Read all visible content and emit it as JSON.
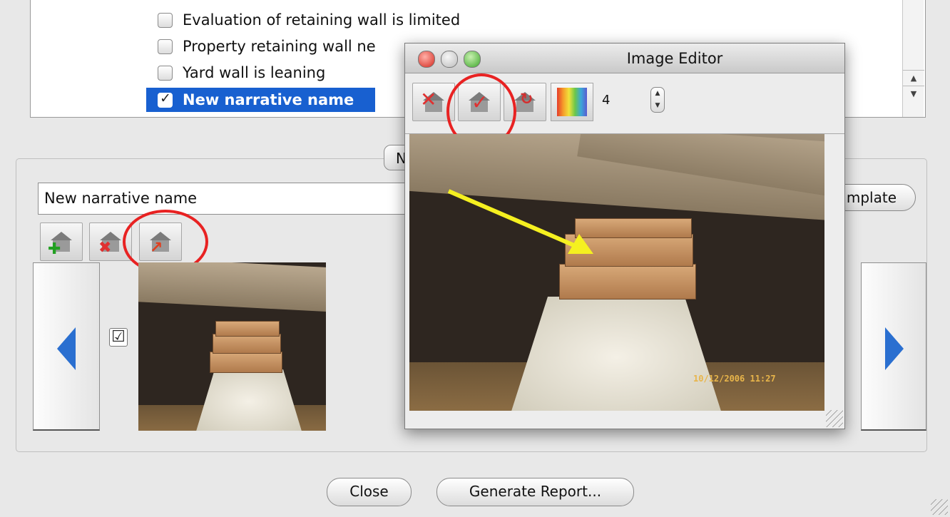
{
  "narrative_list": {
    "items": [
      {
        "label": "Evaluation of retaining wall is limited",
        "checked": false
      },
      {
        "label": "Property retaining wall ne",
        "checked": false
      },
      {
        "label": "Yard wall is leaning",
        "checked": false
      },
      {
        "label": "New narrative name",
        "checked": true,
        "selected": true
      }
    ]
  },
  "narrative_editor": {
    "tab_label": "N",
    "name_value": "New narrative name",
    "template_button_label": "mplate",
    "thumbnail_checked": "☑"
  },
  "image_editor": {
    "title": "Image Editor",
    "level_value": "4",
    "photo_timestamp": "10/12/2006 11:27"
  },
  "footer": {
    "close_label": "Close",
    "generate_label": "Generate Report..."
  },
  "colors": {
    "selection": "#1860d0",
    "annotation": "#e82222",
    "arrow_blue": "#2a6fd0",
    "annotation_arrow": "#f5f020"
  }
}
